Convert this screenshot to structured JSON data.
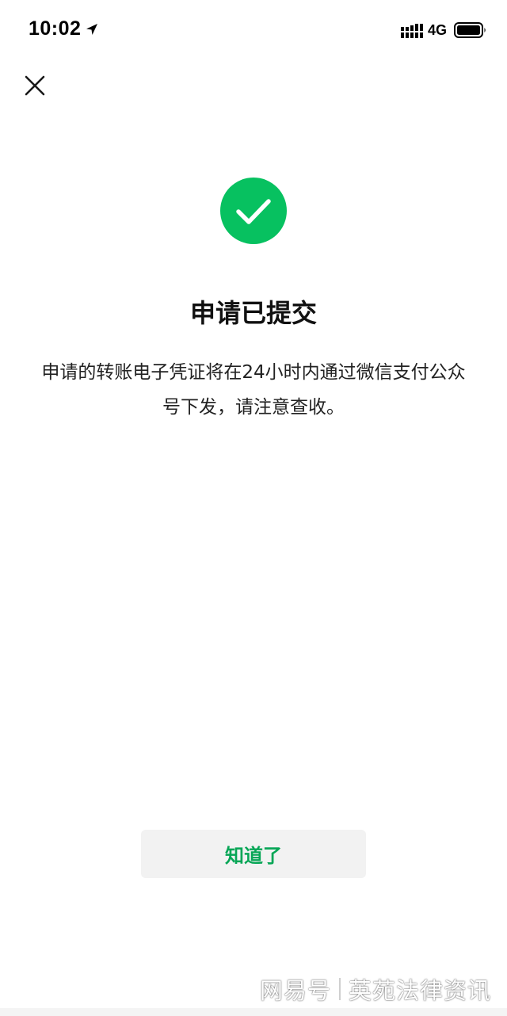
{
  "status_bar": {
    "time": "10:02",
    "network": "4G",
    "icons": [
      "location-arrow-icon",
      "signal-bars-icon",
      "battery-icon"
    ]
  },
  "nav": {
    "close_icon": "close-icon"
  },
  "result": {
    "icon": "check-circle-icon",
    "title": "申请已提交",
    "description": "申请的转账电子凭证将在24小时内通过微信支付公众号下发，请注意查收。"
  },
  "actions": {
    "confirm_label": "知道了"
  },
  "watermark": {
    "platform": "网易号",
    "account": "英苑法律资讯"
  },
  "colors": {
    "accent_green": "#07C160",
    "button_text_green": "#07A656",
    "button_bg": "#F2F2F2",
    "text_primary": "#111111"
  }
}
